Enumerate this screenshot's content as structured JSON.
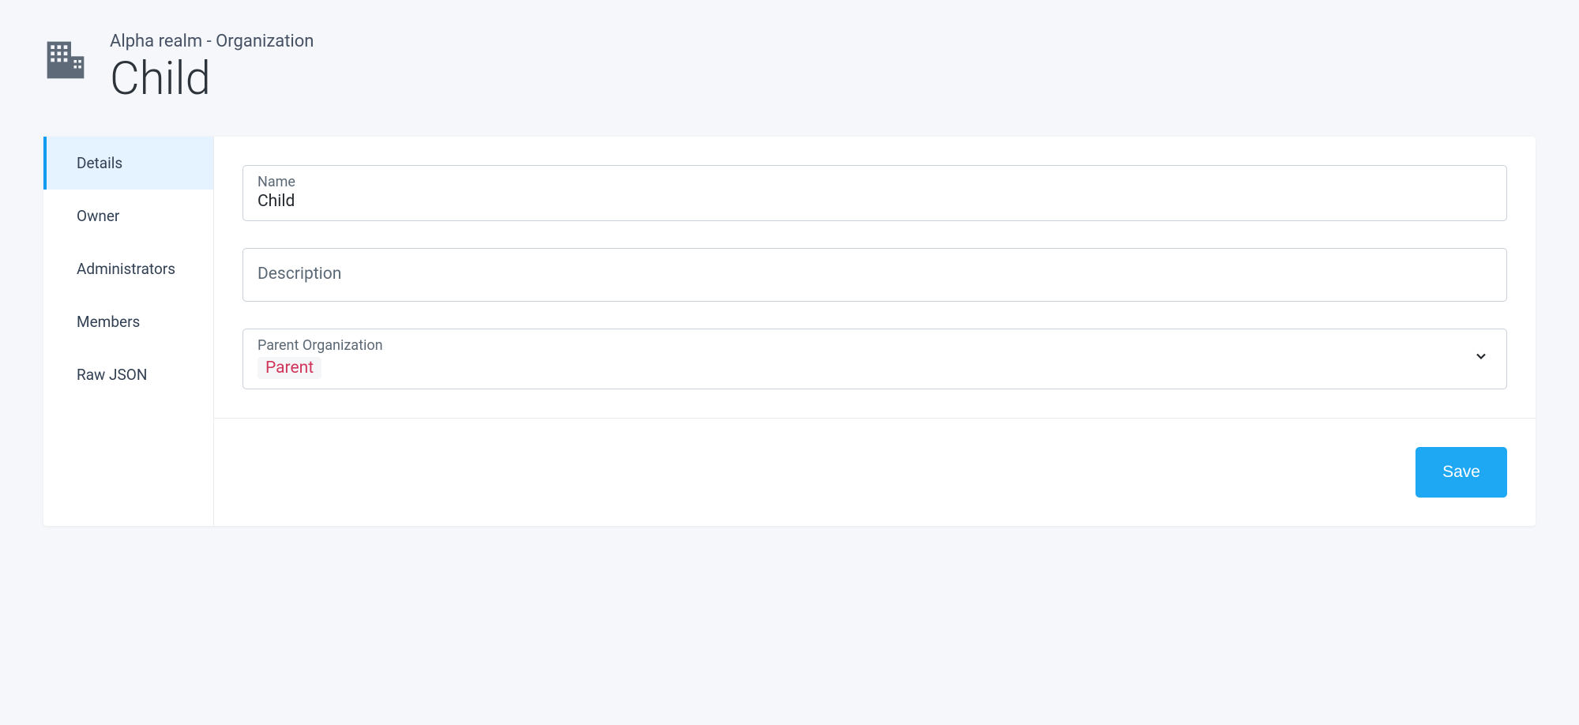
{
  "header": {
    "breadcrumb": "Alpha realm - Organization",
    "title": "Child"
  },
  "sidebar": {
    "items": [
      {
        "label": "Details",
        "active": true
      },
      {
        "label": "Owner",
        "active": false
      },
      {
        "label": "Administrators",
        "active": false
      },
      {
        "label": "Members",
        "active": false
      },
      {
        "label": "Raw JSON",
        "active": false
      }
    ]
  },
  "form": {
    "name": {
      "label": "Name",
      "value": "Child"
    },
    "description": {
      "label": "Description",
      "value": ""
    },
    "parent": {
      "label": "Parent Organization",
      "selected": "Parent"
    }
  },
  "actions": {
    "save_label": "Save"
  },
  "colors": {
    "accent": "#1ea7f3",
    "chip_text": "#d1365b",
    "sidebar_active_bg": "#e4f3ff"
  }
}
